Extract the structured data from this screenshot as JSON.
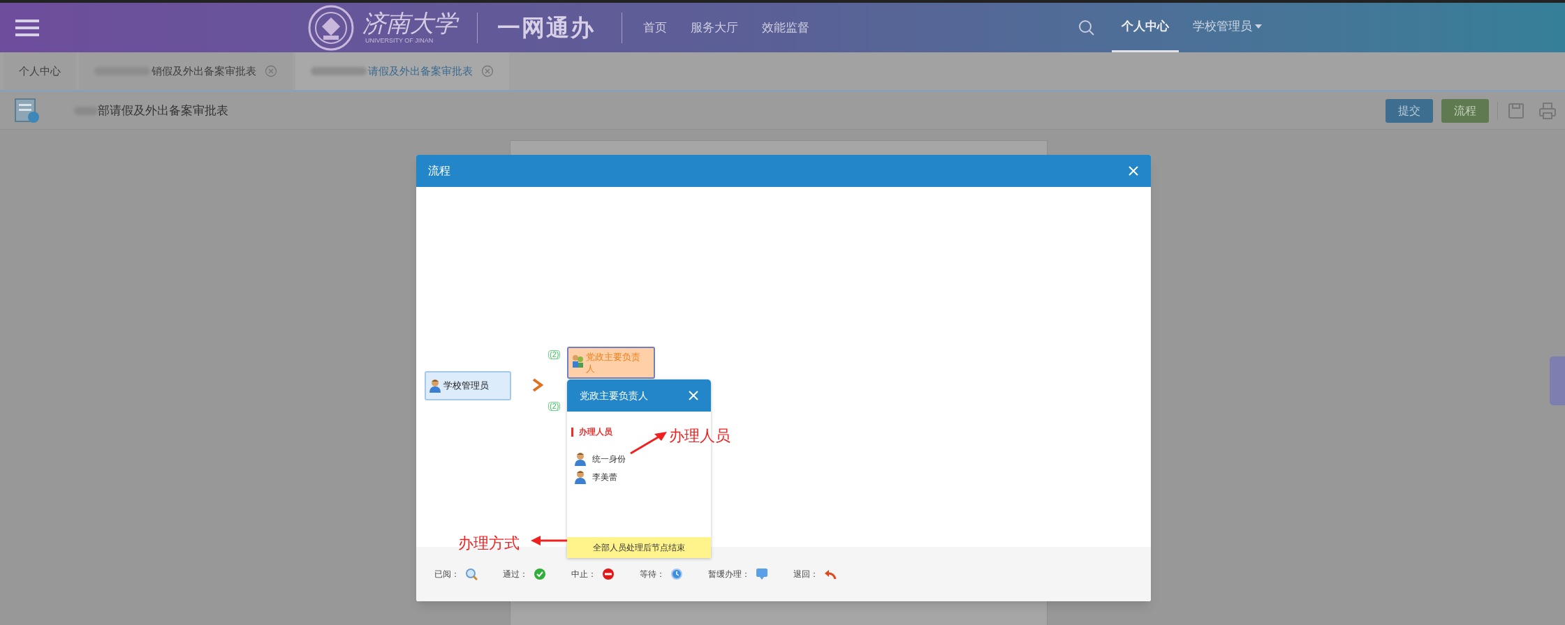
{
  "header": {
    "logo_text": "济南大学",
    "logo_subtext": "UNIVERSITY OF JINAN",
    "app_name": "一网通办",
    "nav": [
      {
        "label": "首页"
      },
      {
        "label": "服务大厅"
      },
      {
        "label": "效能监督"
      }
    ],
    "user_nav": [
      {
        "label": "个人中心",
        "selected": true
      },
      {
        "label": "学校管理员",
        "selected": false,
        "dropdown": true
      }
    ]
  },
  "tabs": [
    {
      "label": "个人中心",
      "selected": false,
      "closable": false,
      "redacted": false
    },
    {
      "label": "销假及外出备案审批表",
      "selected": false,
      "closable": true,
      "redacted": true
    },
    {
      "label": "请假及外出备案审批表",
      "selected": true,
      "closable": true,
      "redacted": true
    }
  ],
  "form": {
    "title": "部请假及外出备案审批表",
    "redacted": true,
    "buttons": [
      {
        "label": "提交",
        "kind": "primary"
      },
      {
        "label": "流程",
        "kind": "success"
      }
    ]
  },
  "dialog": {
    "title": "流程",
    "flow": {
      "start": {
        "label": "学校管理员"
      },
      "badges": [
        "(2)",
        "(2)"
      ],
      "node": {
        "label": "党政主要负责人"
      },
      "popup": {
        "title": "党政主要负责人",
        "section": "办理人员",
        "people": [
          "统一身份",
          "李美蕾"
        ],
        "mode": "全部人员处理后节点结束"
      },
      "annotations": [
        {
          "label": "办理人员",
          "kind": "people"
        },
        {
          "label": "办理方式",
          "kind": "mode"
        }
      ]
    },
    "legend": [
      {
        "label": "已阅：",
        "kind": "read"
      },
      {
        "label": "通过：",
        "kind": "pass"
      },
      {
        "label": "中止：",
        "kind": "stop"
      },
      {
        "label": "等待：",
        "kind": "wait"
      },
      {
        "label": "暂缓办理：",
        "kind": "defer"
      },
      {
        "label": "退回：",
        "kind": "return"
      }
    ]
  }
}
